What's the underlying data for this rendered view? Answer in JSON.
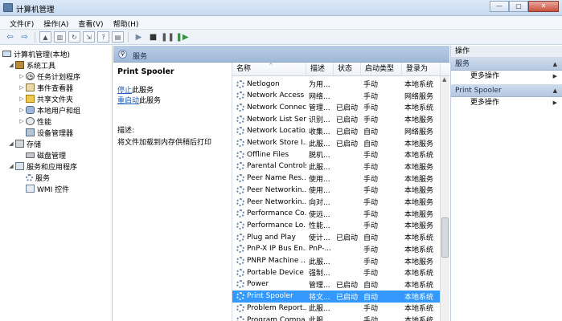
{
  "window": {
    "title": "计算机管理",
    "btn_min": "—",
    "btn_max": "▢",
    "btn_close": "✕"
  },
  "menu": [
    "文件(F)",
    "操作(A)",
    "查看(V)",
    "帮助(H)"
  ],
  "toolbar": {
    "icons": [
      "back-arrow-icon",
      "forward-arrow-icon",
      "up-folder-icon",
      "show-tree-icon",
      "refresh-icon",
      "export-icon",
      "help-icon",
      "properties-icon",
      "play-icon",
      "stop-icon",
      "pause-icon",
      "restart-icon"
    ]
  },
  "tree": {
    "root": "计算机管理(本地)",
    "items": [
      {
        "label": "系统工具",
        "level": 1,
        "exp": "◢"
      },
      {
        "label": "任务计划程序",
        "level": 2,
        "exp": "▷"
      },
      {
        "label": "事件查看器",
        "level": 2,
        "exp": "▷"
      },
      {
        "label": "共享文件夹",
        "level": 2,
        "exp": "▷"
      },
      {
        "label": "本地用户和组",
        "level": 2,
        "exp": "▷"
      },
      {
        "label": "性能",
        "level": 2,
        "exp": "▷"
      },
      {
        "label": "设备管理器",
        "level": 2,
        "exp": ""
      },
      {
        "label": "存储",
        "level": 1,
        "exp": "◢"
      },
      {
        "label": "磁盘管理",
        "level": 2,
        "exp": ""
      },
      {
        "label": "服务和应用程序",
        "level": 1,
        "exp": "◢"
      },
      {
        "label": "服务",
        "level": 2,
        "exp": ""
      },
      {
        "label": "WMI 控件",
        "level": 2,
        "exp": ""
      }
    ]
  },
  "middle": {
    "header_title": "服务",
    "detail": {
      "service_name": "Print Spooler",
      "stop_link": "停止",
      "stop_suffix": "此服务",
      "restart_link": "重启动",
      "restart_suffix": "此服务",
      "desc_label": "描述:",
      "desc_text": "将文件加载到内存供稍后打印"
    },
    "columns": [
      "名称",
      "描述",
      "状态",
      "启动类型",
      "登录为"
    ],
    "rows": [
      {
        "name": "Netlogon",
        "desc": "为用...",
        "status": "",
        "start": "手动",
        "logon": "本地系统"
      },
      {
        "name": "Network Access ...",
        "desc": "网络...",
        "status": "",
        "start": "手动",
        "logon": "网络服务"
      },
      {
        "name": "Network Connec...",
        "desc": "管理...",
        "status": "已启动",
        "start": "手动",
        "logon": "本地系统"
      },
      {
        "name": "Network List Ser...",
        "desc": "识别...",
        "status": "已启动",
        "start": "手动",
        "logon": "本地服务"
      },
      {
        "name": "Network Locatio...",
        "desc": "收集...",
        "status": "已启动",
        "start": "自动",
        "logon": "网络服务"
      },
      {
        "name": "Network Store I...",
        "desc": "此服...",
        "status": "已启动",
        "start": "自动",
        "logon": "本地服务"
      },
      {
        "name": "Offline Files",
        "desc": "脱机...",
        "status": "",
        "start": "手动",
        "logon": "本地系统"
      },
      {
        "name": "Parental Controls",
        "desc": "此服...",
        "status": "",
        "start": "手动",
        "logon": "本地服务"
      },
      {
        "name": "Peer Name Res...",
        "desc": "使用...",
        "status": "",
        "start": "手动",
        "logon": "本地服务"
      },
      {
        "name": "Peer Networkin...",
        "desc": "使用...",
        "status": "",
        "start": "手动",
        "logon": "本地服务"
      },
      {
        "name": "Peer Networkin...",
        "desc": "向对...",
        "status": "",
        "start": "手动",
        "logon": "本地服务"
      },
      {
        "name": "Performance Co...",
        "desc": "使远...",
        "status": "",
        "start": "手动",
        "logon": "本地服务"
      },
      {
        "name": "Performance Lo...",
        "desc": "性能...",
        "status": "",
        "start": "手动",
        "logon": "本地服务"
      },
      {
        "name": "Plug and Play",
        "desc": "使计...",
        "status": "已启动",
        "start": "自动",
        "logon": "本地系统"
      },
      {
        "name": "PnP-X IP Bus En...",
        "desc": "PnP-...",
        "status": "",
        "start": "手动",
        "logon": "本地系统"
      },
      {
        "name": "PNRP Machine ...",
        "desc": "此服...",
        "status": "",
        "start": "手动",
        "logon": "本地服务"
      },
      {
        "name": "Portable Device ...",
        "desc": "强制...",
        "status": "",
        "start": "手动",
        "logon": "本地系统"
      },
      {
        "name": "Power",
        "desc": "管理...",
        "status": "已启动",
        "start": "自动",
        "logon": "本地系统"
      },
      {
        "name": "Print Spooler",
        "desc": "将文...",
        "status": "已启动",
        "start": "自动",
        "logon": "本地系统"
      },
      {
        "name": "Problem Report...",
        "desc": "此服...",
        "status": "",
        "start": "手动",
        "logon": "本地系统"
      },
      {
        "name": "Program Compa...",
        "desc": "此服...",
        "status": "",
        "start": "手动",
        "logon": "本地系统"
      }
    ],
    "selected_row_index": 18
  },
  "actions": {
    "title": "操作",
    "groups": [
      {
        "label": "服务",
        "item": "更多操作"
      },
      {
        "label": "Print Spooler",
        "item": "更多操作"
      }
    ]
  },
  "colors": {
    "selection": "#3399ff",
    "link": "#1e5fbf",
    "header_gradient": "#b9cde6"
  }
}
